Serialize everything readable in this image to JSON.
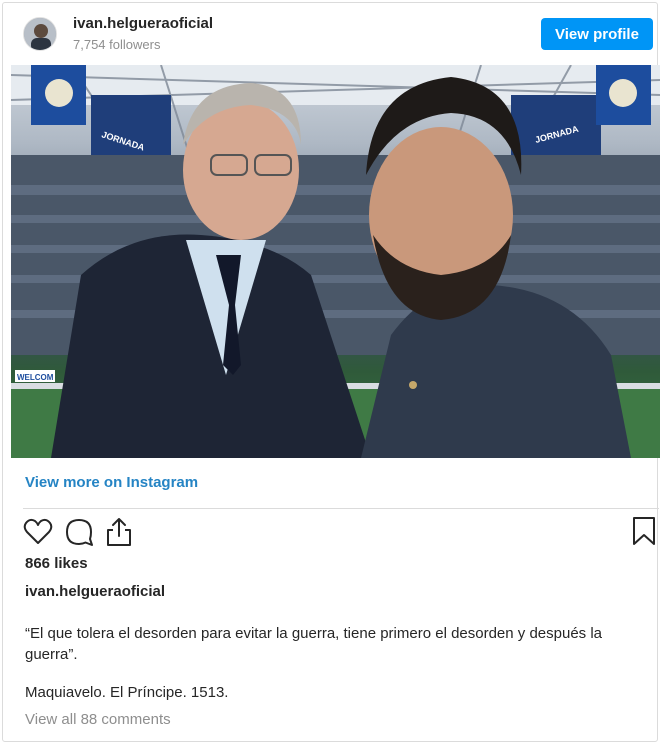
{
  "header": {
    "username": "ivan.helgueraoficial",
    "followers": "7,754 followers",
    "view_profile_label": "View profile"
  },
  "media": {
    "banner_left": "JORNADA",
    "banner_right": "JORNADA",
    "welcome_sign": "WELCOM"
  },
  "view_more_label": "View more on Instagram",
  "actions": {
    "like_icon": "heart-icon",
    "comment_icon": "comment-icon",
    "share_icon": "share-icon",
    "save_icon": "bookmark-icon"
  },
  "likes": "866 likes",
  "caption": {
    "username": "ivan.helgueraoficial",
    "quote": "“El que tolera el desorden para evitar la guerra, tiene primero el desorden y después la guerra”.",
    "source": "Maquiavelo. El Príncipe. 1513."
  },
  "comments_link": "View all 88 comments",
  "colors": {
    "accent_button": "#0095f6",
    "link": "#2584c4",
    "muted": "#8e8e8e"
  }
}
